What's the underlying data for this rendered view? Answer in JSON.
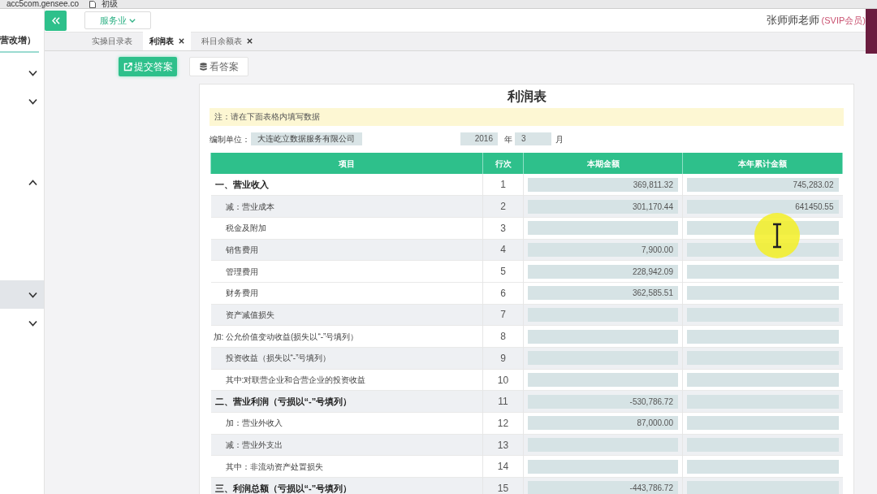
{
  "browser_bar": {
    "address": "acc5com.gensee.co",
    "bookmark": "初级"
  },
  "sidebar": {
    "title": "营改增）",
    "items": [
      {
        "expanded": false,
        "selected": false
      },
      {
        "expanded": false,
        "selected": false
      },
      {
        "expanded": true,
        "selected": false
      },
      {
        "expanded": false,
        "selected": true
      },
      {
        "expanded": false,
        "selected": false
      }
    ]
  },
  "header": {
    "industry_dropdown": "服务业",
    "user_name": "张师师老师",
    "user_level": "(SVIP会员)"
  },
  "tabs": [
    {
      "label": "实操目录表",
      "selected": false,
      "closable": false
    },
    {
      "label": "利润表",
      "selected": true,
      "closable": true
    },
    {
      "label": "科目余额表",
      "selected": false,
      "closable": true
    }
  ],
  "toolbar": {
    "submit": "提交答案",
    "view_answer": "看答案"
  },
  "report": {
    "title": "利润表",
    "note": "注：请在下面表格内填写数据",
    "company_label": "编制单位：",
    "company": "大连屹立数据服务有限公司",
    "year": "2016",
    "year_unit": "年",
    "month": "3",
    "month_unit": "月",
    "columns": [
      "项目",
      "行次",
      "本期金额",
      "本年累计金额"
    ],
    "rows": [
      {
        "item": "一、营业收入",
        "kind": "section",
        "line": "1",
        "current": "369,811.32",
        "year_to_date": "745,283.02",
        "shaded": false
      },
      {
        "item": "减：营业成本",
        "kind": "item",
        "line": "2",
        "current": "301,170.44",
        "year_to_date": "641450.55",
        "shaded": true
      },
      {
        "item": "税金及附加",
        "kind": "item",
        "line": "3",
        "shaded": false
      },
      {
        "item": "销售费用",
        "kind": "item",
        "line": "4",
        "current": "7,900.00",
        "shaded": true
      },
      {
        "item": "管理费用",
        "kind": "item",
        "line": "5",
        "current": "228,942.09",
        "shaded": false
      },
      {
        "item": "财务费用",
        "kind": "item",
        "line": "6",
        "current": "362,585.51",
        "shaded": false
      },
      {
        "item": "资产减值损失",
        "kind": "item",
        "line": "7",
        "shaded": true
      },
      {
        "item": "加: 公允价值变动收益(损失以“-”号填列）",
        "kind": "adjustment",
        "line": "8",
        "shaded": false
      },
      {
        "item": "投资收益（损失以“-”号填列）",
        "kind": "item",
        "line": "9",
        "shaded": true
      },
      {
        "item": "其中:对联营企业和合营企业的投资收益",
        "kind": "item",
        "line": "10",
        "shaded": false
      },
      {
        "item": "二、营业利润（亏损以“-”号填列）",
        "kind": "section",
        "line": "11",
        "current": "-530,786.72",
        "shaded": true
      },
      {
        "item": "加：营业外收入",
        "kind": "item",
        "line": "12",
        "current": "87,000.00",
        "shaded": false
      },
      {
        "item": "减：营业外支出",
        "kind": "item",
        "line": "13",
        "shaded": true
      },
      {
        "item": "其中：非流动资产处置损失",
        "kind": "item",
        "line": "14",
        "shaded": false
      },
      {
        "item": "三、利润总额（亏损以“-”号填列）",
        "kind": "section",
        "line": "15",
        "current": "-443,786.72",
        "shaded": true
      }
    ]
  }
}
